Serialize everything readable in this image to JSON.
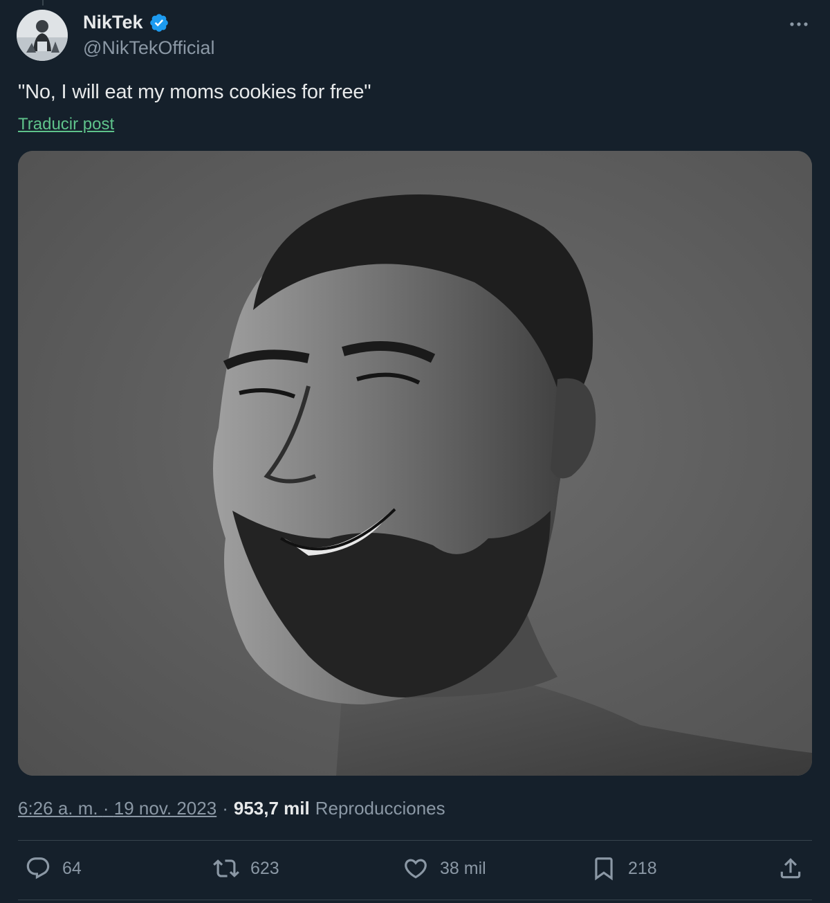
{
  "author": {
    "display_name": "NikTek",
    "handle": "@NikTekOfficial",
    "verified": true,
    "verified_color": "#1d9bf0"
  },
  "tweet": {
    "text": "\"No, I will eat my moms cookies for free\"",
    "translate_label": "Traducir post",
    "media_icon": "photo-chad-portrait"
  },
  "meta": {
    "time": "6:26 a. m.",
    "separator1": "·",
    "date": "19 nov. 2023",
    "separator2": "·",
    "views_count": "953,7 mil",
    "views_label": "Reproducciones"
  },
  "actions": {
    "replies": "64",
    "retweets": "623",
    "likes": "38 mil",
    "bookmarks": "218"
  },
  "colors": {
    "background": "#15202b",
    "text": "#e7e9ea",
    "muted": "#8b98a5",
    "link": "#5fc38b",
    "border": "#38444d"
  }
}
